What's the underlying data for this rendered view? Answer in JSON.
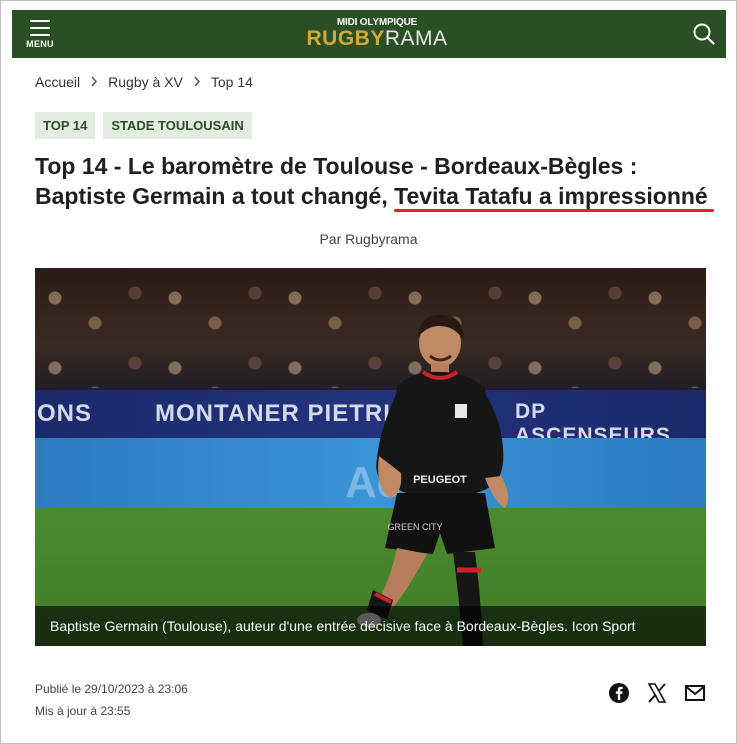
{
  "header": {
    "menu_label": "MENU",
    "logo_top": "MIDI OLYMPIQUE",
    "logo_part1": "RUGBY",
    "logo_part2": "RAMA",
    "brand_color": "#2b4f25",
    "logo_gold": "#d4a93a"
  },
  "breadcrumb": [
    "Accueil",
    "Rugby à XV",
    "Top 14"
  ],
  "tags": [
    "TOP 14",
    "STADE TOULOUSAIN"
  ],
  "article": {
    "title_part1": "Top 14 - Le baromètre de Toulouse - Bordeaux-Bègles : Baptiste Germain a tout changé, ",
    "title_highlight": "Tevita Tatafu a impressionné",
    "highlight_color": "#e0202a",
    "author": "Par Rugbyrama",
    "image_caption": "Baptiste Germain (Toulouse), auteur d'une entrée décisive face à Bordeaux-Bègles. Icon Sport",
    "published": "Publié le 29/10/2023 à 23:06",
    "updated": "Mis à jour à 23:55"
  },
  "hero": {
    "banner_left": "ONS",
    "banner_mid": "MONTANER PIETRINI",
    "banner_right": "DP ASCENSEURS FERN",
    "ad_text": "Ac",
    "jersey_sponsor": "PEUGEOT",
    "shorts_sponsor": "GREEN CITY"
  },
  "share": {
    "icons": [
      "facebook-icon",
      "x-icon",
      "mail-icon"
    ]
  }
}
